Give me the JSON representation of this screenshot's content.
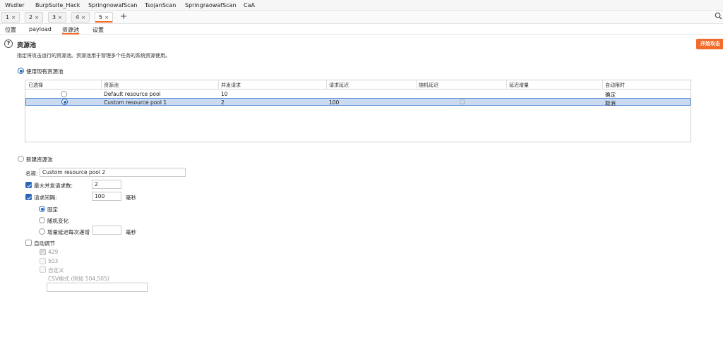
{
  "extensions": [
    "Wsdler",
    "BurpSuite_Hack",
    "SpringnowafScan",
    "TsojanScan",
    "SpringraowafScan",
    "CaA"
  ],
  "tabs": [
    {
      "label": "1",
      "close": "×"
    },
    {
      "label": "2",
      "close": "×"
    },
    {
      "label": "3",
      "close": "×"
    },
    {
      "label": "4",
      "close": "×"
    },
    {
      "label": "5",
      "close": "×",
      "active": true
    }
  ],
  "add_tab": "+",
  "subtabs": [
    "位置",
    "payload",
    "资源池",
    "设置"
  ],
  "active_subtab": "资源池",
  "section": {
    "title": "资源池",
    "help": "?",
    "description": "指定将攻击运行的资源池。资源池用于管理多个任务的系统资源使用。",
    "start_button": "开始攻击"
  },
  "use_existing": {
    "label": "使用现有资源池",
    "selected": true,
    "columns": [
      "已选择",
      "资源池",
      "并发请求",
      "请求延迟",
      "随机延迟",
      "延迟增量",
      "自动限时"
    ],
    "rows": [
      {
        "selected": false,
        "pool": "Default resource pool",
        "concurrent": "10",
        "delay": "",
        "random": "",
        "increment": "",
        "auto": "确定"
      },
      {
        "selected": true,
        "pool": "Custom resource pool 1",
        "concurrent": "2",
        "delay": "100",
        "random": "",
        "increment": "",
        "auto": "取消"
      }
    ]
  },
  "new_pool": {
    "label": "新建资源池",
    "selected": false,
    "name_label": "名称:",
    "name_value": "Custom resource pool 2",
    "max_concurrent_label": "最大并发请求数:",
    "max_concurrent_value": "2",
    "interval_label": "请求间隔:",
    "interval_value": "100",
    "interval_unit": "毫秒",
    "fixed_label": "固定",
    "random_label": "随机变化",
    "increment_label": "增量延迟每次递增",
    "increment_unit": "毫秒",
    "auto_throttle_label": "自动调节",
    "codes": [
      "429",
      "503"
    ],
    "custom_label": "自定义",
    "csv_label": "CSV格式 (例如 504,505)"
  },
  "colors": {
    "accent": "#f26b2a",
    "selection": "#c9daf1",
    "check": "#2a66b8"
  }
}
